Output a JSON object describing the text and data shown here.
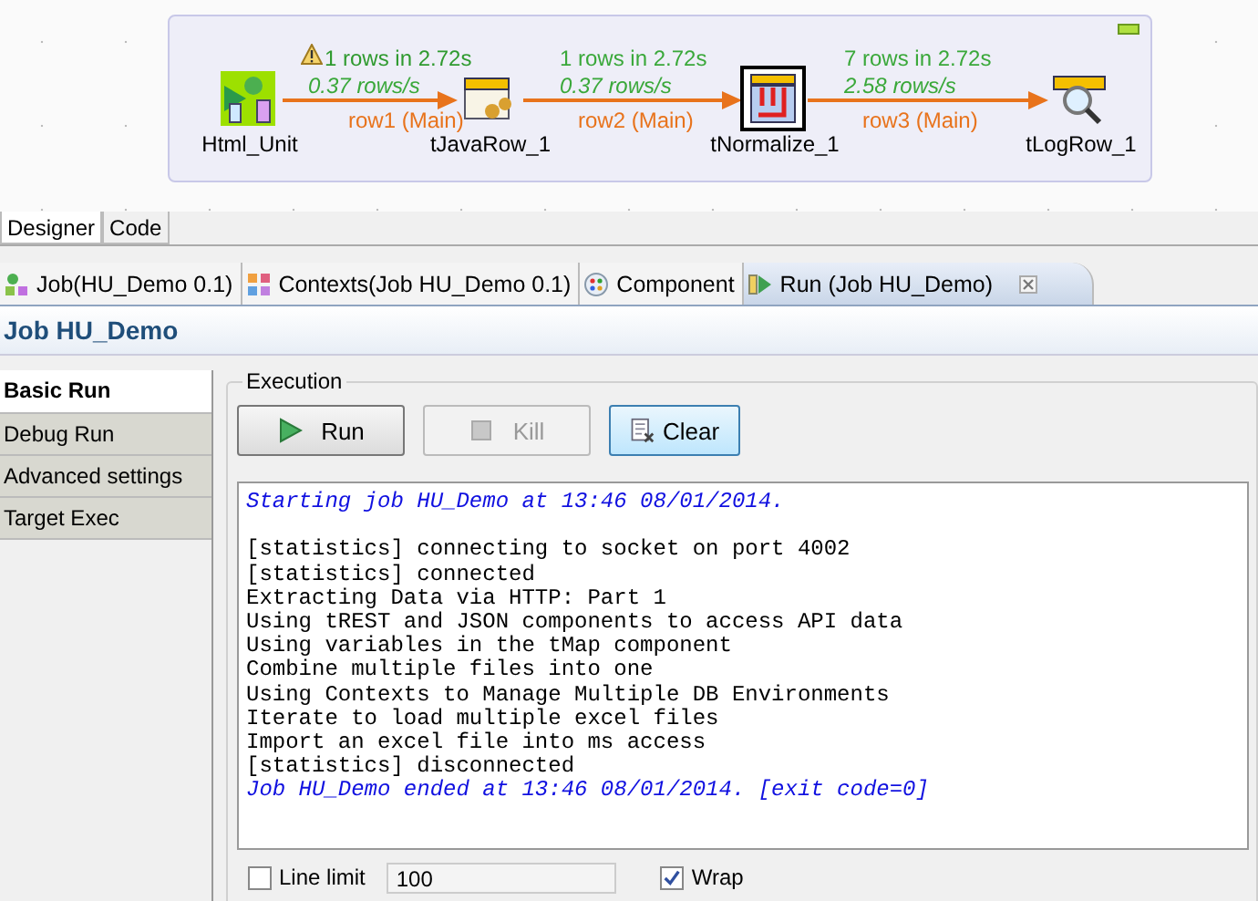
{
  "diagram": {
    "nodes": [
      {
        "label": "Html_Unit",
        "kind": "source",
        "selected": false
      },
      {
        "label": "tJavaRow_1",
        "kind": "java",
        "selected": false
      },
      {
        "label": "tNormalize_1",
        "kind": "normalize",
        "selected": true
      },
      {
        "label": "tLogRow_1",
        "kind": "log",
        "selected": false
      }
    ],
    "links": [
      {
        "stats": "1 rows in 2.72s",
        "rate": "0.37 rows/s",
        "label": "row1 (Main)",
        "warning": true
      },
      {
        "stats": "1 rows in 2.72s",
        "rate": "0.37 rows/s",
        "label": "row2 (Main)",
        "warning": false
      },
      {
        "stats": "7 rows in 2.72s",
        "rate": "2.58 rows/s",
        "label": "row3 (Main)",
        "warning": false
      }
    ]
  },
  "editor_tabs": [
    {
      "label": "Designer",
      "selected": true
    },
    {
      "label": "Code",
      "selected": false
    }
  ],
  "view_tabs": [
    {
      "label": "Job(HU_Demo 0.1)",
      "kind": "job",
      "selected": false,
      "closable": false
    },
    {
      "label": "Contexts(Job HU_Demo 0.1)",
      "kind": "contexts",
      "selected": false,
      "closable": false
    },
    {
      "label": "Component",
      "kind": "component",
      "selected": false,
      "closable": false
    },
    {
      "label": "Run (Job HU_Demo)",
      "kind": "run",
      "selected": true,
      "closable": true
    }
  ],
  "panel_title": "Job HU_Demo",
  "side_tabs": [
    {
      "label": "Basic Run",
      "selected": true
    },
    {
      "label": "Debug Run",
      "selected": false
    },
    {
      "label": "Advanced settings",
      "selected": false
    },
    {
      "label": "Target Exec",
      "selected": false
    }
  ],
  "execution": {
    "title": "Execution",
    "buttons": [
      {
        "label": "Run",
        "kind": "run",
        "disabled": false,
        "focused": false
      },
      {
        "label": "Kill",
        "kind": "kill",
        "disabled": true,
        "focused": false
      },
      {
        "label": "Clear",
        "kind": "clear",
        "disabled": false,
        "focused": true
      }
    ],
    "log": [
      {
        "text": "Starting job HU_Demo at 13:46 08/01/2014.",
        "kind": "system"
      },
      {
        "kind": "blank"
      },
      {
        "text": "[statistics] connecting to socket on port 4002",
        "kind": "output"
      },
      {
        "text": "[statistics] connected",
        "kind": "output"
      },
      {
        "text": "Extracting Data via HTTP: Part 1",
        "kind": "output"
      },
      {
        "text": "Using tREST and JSON components to access API data",
        "kind": "output"
      },
      {
        "text": "Using variables in the tMap component",
        "kind": "output"
      },
      {
        "text": "Combine multiple files into one",
        "kind": "output"
      },
      {
        "text": "Using Contexts to Manage Multiple DB Environments",
        "kind": "output"
      },
      {
        "text": "Iterate to load multiple excel files",
        "kind": "output"
      },
      {
        "text": "Import an excel file into ms access",
        "kind": "output"
      },
      {
        "text": "[statistics] disconnected",
        "kind": "output"
      },
      {
        "text": "Job HU_Demo ended at 13:46 08/01/2014. [exit code=0]",
        "kind": "system"
      }
    ],
    "line_limit": {
      "label": "Line limit",
      "checked": false,
      "value": "100"
    },
    "wrap": {
      "label": "Wrap",
      "checked": true
    }
  }
}
